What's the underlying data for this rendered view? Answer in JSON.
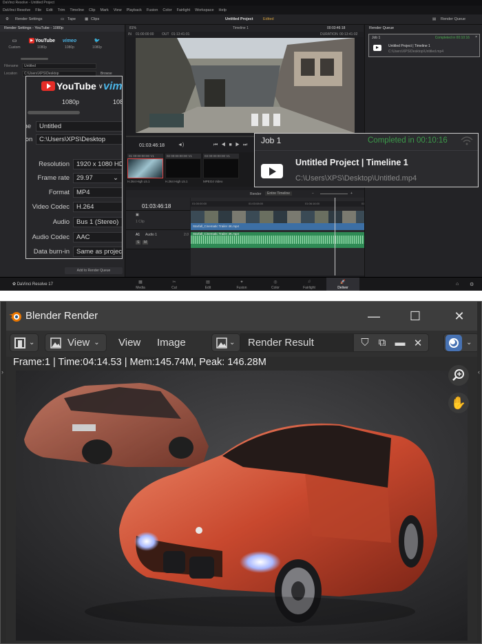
{
  "resolve": {
    "window_title": "DaVinci Resolve - Untitled Project",
    "menu": [
      "DaVinci Resolve",
      "File",
      "Edit",
      "Trim",
      "Timeline",
      "Clip",
      "Mark",
      "View",
      "Playback",
      "Fusion",
      "Color",
      "Fairlight",
      "Workspace",
      "Help"
    ],
    "toolbar": {
      "render_settings": "Render Settings",
      "tape": "Tape",
      "clips": "Clips",
      "project": "Untitled Project",
      "edited": "Edited",
      "render_queue": "Render Queue"
    },
    "left_panel": {
      "header": "Render Settings - YouTube - 1080p",
      "presets": [
        {
          "name": "Custom",
          "res": "",
          "icon": "custom-icon"
        },
        {
          "name": "YouTube",
          "res": "1080p",
          "icon": "youtube-icon"
        },
        {
          "name": "vimeo",
          "res": "1080p",
          "icon": "vimeo-icon"
        },
        {
          "name": "Twitter",
          "res": "1080p",
          "icon": "twitter-icon"
        }
      ],
      "filename_label": "Filename",
      "filename_value": "Untitled",
      "location_label": "Location",
      "location_value": "C:\\Users\\XPS\\Desktop",
      "browse": "Browse",
      "add_to_queue": "Add to Render Queue"
    },
    "zoom_panel": {
      "youtube_label": "YouTube",
      "vimeo_label": "vim",
      "res_youtube": "1080p",
      "res_vimeo": "108",
      "name_label": "me",
      "name_value": "Untitled",
      "location_label": "tion",
      "location_value": "C:\\Users\\XPS\\Desktop",
      "fields": [
        {
          "label": "Resolution",
          "value": "1920 x 1080 HD"
        },
        {
          "label": "Frame rate",
          "value": "29.97"
        },
        {
          "label": "Format",
          "value": "MP4"
        },
        {
          "label": "Video Codec",
          "value": "H.264"
        },
        {
          "label": "Audio",
          "value": "Bus 1 (Stereo)"
        },
        {
          "label": "Audio Codec",
          "value": "AAC"
        },
        {
          "label": "Data burn-in",
          "value": "Same as project"
        }
      ]
    },
    "viewer": {
      "zoom": "81%",
      "timeline_name": "Timeline 1",
      "in_label": "IN",
      "in_time": "01:00:00:00",
      "out_label": "OUT",
      "out_time": "01:13:41:01",
      "timecode_top": "00:03:46:18",
      "duration_label": "DURATION",
      "duration": "00:13:41:02",
      "current_time": "01:03:46:18"
    },
    "clips": [
      {
        "id": "01",
        "tc": "00:00:00:00",
        "track": "V1",
        "caption": "H.264 High L5.1"
      },
      {
        "id": "02",
        "tc": "00:00:00:00",
        "track": "V1",
        "caption": "H.264 High L5.1"
      },
      {
        "id": "03",
        "tc": "00:00:00:00",
        "track": "V1",
        "caption": "MPEG4 Video"
      }
    ],
    "timeline": {
      "render_label": "Render",
      "render_mode": "Entire Timeline",
      "timecode": "01:03:46:18",
      "ruler": [
        "01:00:00:00",
        "01:03:08:00",
        "01:06:16:00",
        "01:09:24:00",
        "01:12:32:00",
        "01:15:40:00"
      ],
      "video_clip_label": "Starfall_Cinematic Trailer 4K.mp4",
      "audio_track": "A1",
      "audio_name": "Audio 1",
      "audio_channels": "2.0",
      "audio_clip_label": "Starfall_Cinematic Trailer 4K.mp4",
      "clip_count": "1 Clip"
    },
    "pages": [
      "Media",
      "Cut",
      "Edit",
      "Fusion",
      "Color",
      "Fairlight",
      "Deliver"
    ],
    "active_page": "Deliver",
    "brand": "DaVinci Resolve 17",
    "render_queue": {
      "header": "Render Queue",
      "job": "Job 1",
      "status": "Completed in 00:10:16",
      "title": "Untitled Project | Timeline 1",
      "path": "C:\\Users\\XPS\\Desktop\\Untitled.mp4"
    }
  },
  "blender": {
    "window_title": "Blender Render",
    "header": {
      "view_dropdown": "View",
      "view_menu": "View",
      "image_menu": "Image",
      "image_name": "Render Result"
    },
    "info": "Frame:1 | Time:04:14.53 | Mem:145.74M, Peak: 146.28M",
    "colors": {
      "accent": "#4772b3",
      "car_paint": "#d2553a"
    }
  }
}
